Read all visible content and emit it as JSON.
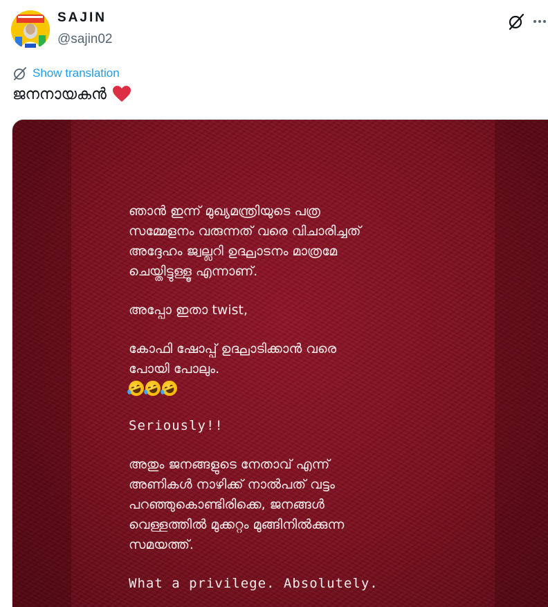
{
  "user": {
    "display_name": "SAJIN",
    "handle": "@sajin02"
  },
  "actions": {
    "grok_icon": "slashed-circle-icon",
    "more_icon": "more-horizontal-icon"
  },
  "translation": {
    "label": "Show translation",
    "icon": "translate-icon"
  },
  "tweet": {
    "text": "ജനനായകൻ"
  },
  "media": {
    "block1": [
      "ഞാൻ ഇന്ന് മുഖ്യമന്ത്രിയുടെ പത്ര",
      "സമ്മേളനം വരുന്നത് വരെ വിചാരിച്ചത്",
      "അദ്ദേഹം ജ്വല്ലറി ഉദ്ഘാടനം മാത്രമേ",
      "ചെയ്തിട്ടുള്ളൂ എന്നാണ്."
    ],
    "line_twist": "അപ്പോ ഇതാ twist,",
    "block2": [
      "കോഫി ഷോപ്പ് ഉദ്ഘാടിക്കാൻ വരെ",
      "പോയി പോലും."
    ],
    "seriously": "Seriously!!",
    "block3": [
      "അതും ജനങ്ങളുടെ നേതാവ് എന്ന്",
      "അണികൾ നാഴിക്ക് നാൽപത് വട്ടം",
      "പറഞ്ഞുകൊണ്ടിരിക്കെ, ജനങ്ങൾ",
      "വെള്ളത്തിൽ മുക്കറ്റം മുങ്ങിനിൽക്കുന്ന",
      "സമയത്ത്."
    ],
    "closing": "What a privilege. Absolutely."
  },
  "colors": {
    "accent": "#1d9bf0",
    "heart": "#f91880",
    "card": "#7a0f1f"
  }
}
